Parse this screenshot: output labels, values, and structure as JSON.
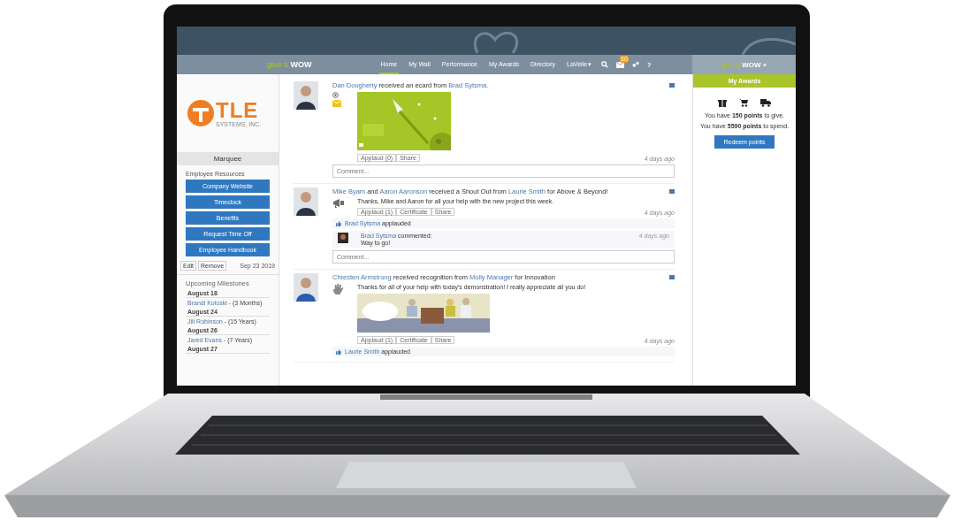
{
  "nav": {
    "brand": {
      "lead": "give a",
      "main": "WOW"
    },
    "items": [
      {
        "label": "Home",
        "selected": true
      },
      {
        "label": "My Wall",
        "selected": false
      },
      {
        "label": "Performance",
        "selected": false
      },
      {
        "label": "My Awards",
        "selected": false
      },
      {
        "label": "Directory",
        "selected": false
      },
      {
        "label": "LaVelle",
        "selected": false,
        "kind": "dropdown",
        "caret": "▾"
      }
    ],
    "badge": "10",
    "help": "?"
  },
  "sidebar": {
    "logo": {
      "main": "TLE",
      "sub": "SYSTEMS, INC."
    },
    "marquee": "Marquee",
    "resources_title": "Employee Resources",
    "resources": [
      "Company Website",
      "Timeclock",
      "Benefits",
      "Request Time Off",
      "Employee Handbook"
    ],
    "edit": "Edit",
    "remove": "Remove",
    "date": "Sep 23 2019",
    "milestones_title": "Upcoming Milestones",
    "milestones": [
      {
        "date": "August 18",
        "name": "Brandi Koloski",
        "detail": " - (3 Months)"
      },
      {
        "date": "August 24",
        "name": "Jill Robinson",
        "detail": " - (15 Years)"
      },
      {
        "date": "August 26",
        "name": "Jared Evans",
        "detail": " - (7 Years)"
      },
      {
        "date": "August 27"
      }
    ]
  },
  "feed": [
    {
      "kind": "ecard",
      "headline": [
        {
          "text": "Dan Dougherty",
          "link": true
        },
        {
          "text": " received an ecard from ",
          "link": false
        },
        {
          "text": "Brad Sytsma.",
          "link": true
        }
      ],
      "image": {
        "kind": "picture"
      },
      "actions": [
        "Applaud (0)",
        "Share"
      ],
      "time": "4 days ago",
      "comment_placeholder": "Comment..."
    },
    {
      "kind": "shoutout",
      "headline": [
        {
          "text": "Mike Byam",
          "link": true
        },
        {
          "text": " and ",
          "link": false
        },
        {
          "text": "Aaron Aaronson",
          "link": true
        },
        {
          "text": " received a Shout Out from ",
          "link": false
        },
        {
          "text": "Laurie Smith",
          "link": true
        },
        {
          "text": " for Above & Beyond!",
          "link": false
        }
      ],
      "message": "Thanks, Mike and Aaron for all your help with the new project this week.",
      "actions": [
        "Applaud (1)",
        "Certificate",
        "Share"
      ],
      "time": "4 days ago",
      "applause": {
        "name": "Brad Sytsma",
        "text": " applauded"
      },
      "comments": [
        {
          "name": "Brad Sytsma",
          "verb": " commented:",
          "text": "Way to go!",
          "time": "4 days ago"
        }
      ],
      "comment_placeholder": "Comment..."
    },
    {
      "kind": "recognition",
      "headline": [
        {
          "text": "Chresten Armstrong",
          "link": true
        },
        {
          "text": " received recognition from ",
          "link": false
        },
        {
          "text": "Molly Manager",
          "link": true
        },
        {
          "text": " for Innovation",
          "link": false
        }
      ],
      "message": "Thanks for all of your help with today's demonstration! I really appreciate all you do!",
      "image": {
        "kind": "picture"
      },
      "actions": [
        "Applaud (1)",
        "Certificate",
        "Share"
      ],
      "time": "4 days ago",
      "applause": {
        "name": "Laurie Smith",
        "text": " applauded"
      }
    }
  ],
  "awards": {
    "brand": {
      "lead": "give a",
      "main": "WOW »"
    },
    "title": "My Awards",
    "lines": [
      "You have **150 points** to give.",
      "You have **5590 points** to spend."
    ],
    "button": "Redeem points"
  }
}
